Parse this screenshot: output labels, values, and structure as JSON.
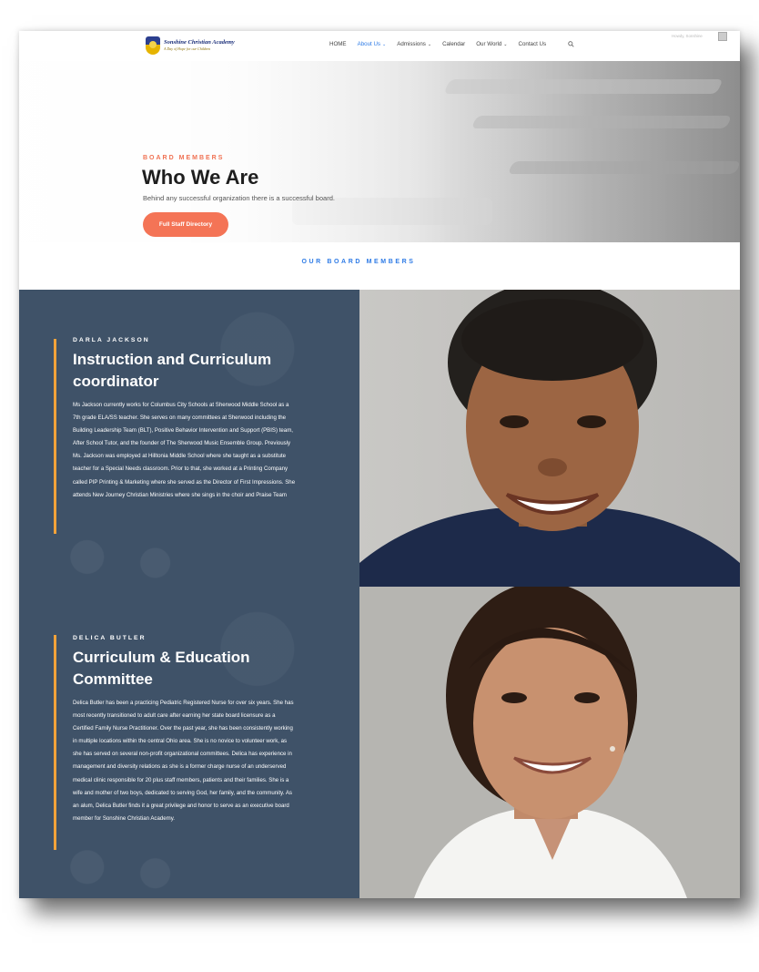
{
  "header": {
    "logo": {
      "name": "Sonshine Christian Academy",
      "tagline": "A Day of Hope for our Children"
    },
    "nav": [
      {
        "label": "HOME",
        "has_dropdown": false,
        "active": false
      },
      {
        "label": "About Us",
        "has_dropdown": true,
        "active": true
      },
      {
        "label": "Admissions",
        "has_dropdown": true,
        "active": false
      },
      {
        "label": "Calendar",
        "has_dropdown": false,
        "active": false
      },
      {
        "label": "Our World",
        "has_dropdown": true,
        "active": false
      },
      {
        "label": "Contact Us",
        "has_dropdown": false,
        "active": false
      }
    ],
    "search_icon": "search-icon",
    "account_text": "Howdy, Sonshine"
  },
  "hero": {
    "kicker": "BOARD MEMBERS",
    "title": "Who We Are",
    "subtitle": "Behind any successful organization there is a successful board.",
    "button_label": "Full Staff Directory"
  },
  "board_heading": "OUR BOARD MEMBERS",
  "members": [
    {
      "name": "DARLA JACKSON",
      "role": "Instruction and Curriculum coordinator",
      "bio": "Ms Jackson currently works for Columbus City Schools at Sherwood Middle School as a 7th grade ELA/SS teacher. She serves on many committees at Sherwood including the Building Leadership Team (BLT), Positive Behavior Intervention and Support (PBIS) team, After School Tutor, and the founder of The Sherwood Music Ensemble Group. Previously Ms. Jackson was employed at Hilltonia Middle School where she taught as a substitute teacher for a Special Needs classroom. Prior to that, she worked at a Printing Company called PIP Printing & Marketing where she served as the Director of First Impressions. She attends New Journey Christian Ministries where she sings in the choir and Praise Team"
    },
    {
      "name": "DELICA BUTLER",
      "role": "Curriculum & Education Committee",
      "bio": "Delica Butler has been a practicing Pediatric Registered Nurse for over six years. She has most recently transitioned to adult care after earning her state board licensure as a Certified Family Nurse Practitioner. Over the past year, she has been consistently working in multiple locations within the central Ohio area. She is no novice to volunteer work, as she has served on several non-profit organizational committees. Delica has experience in management and diversity relations as she is a former charge nurse of an underserved medical clinic responsible for 20 plus staff members, patients and their families. She is a wife and mother of two boys, dedicated to serving God, her family, and the community. As an alum, Delica Butler finds it a great privilege and honor to serve as an executive board member for Sonshine Christian Academy."
    }
  ],
  "colors": {
    "accent_orange": "#f47456",
    "nav_active": "#2e7be6",
    "panel_bg": "#3f5268",
    "accent_bar": "#f2a33a"
  }
}
